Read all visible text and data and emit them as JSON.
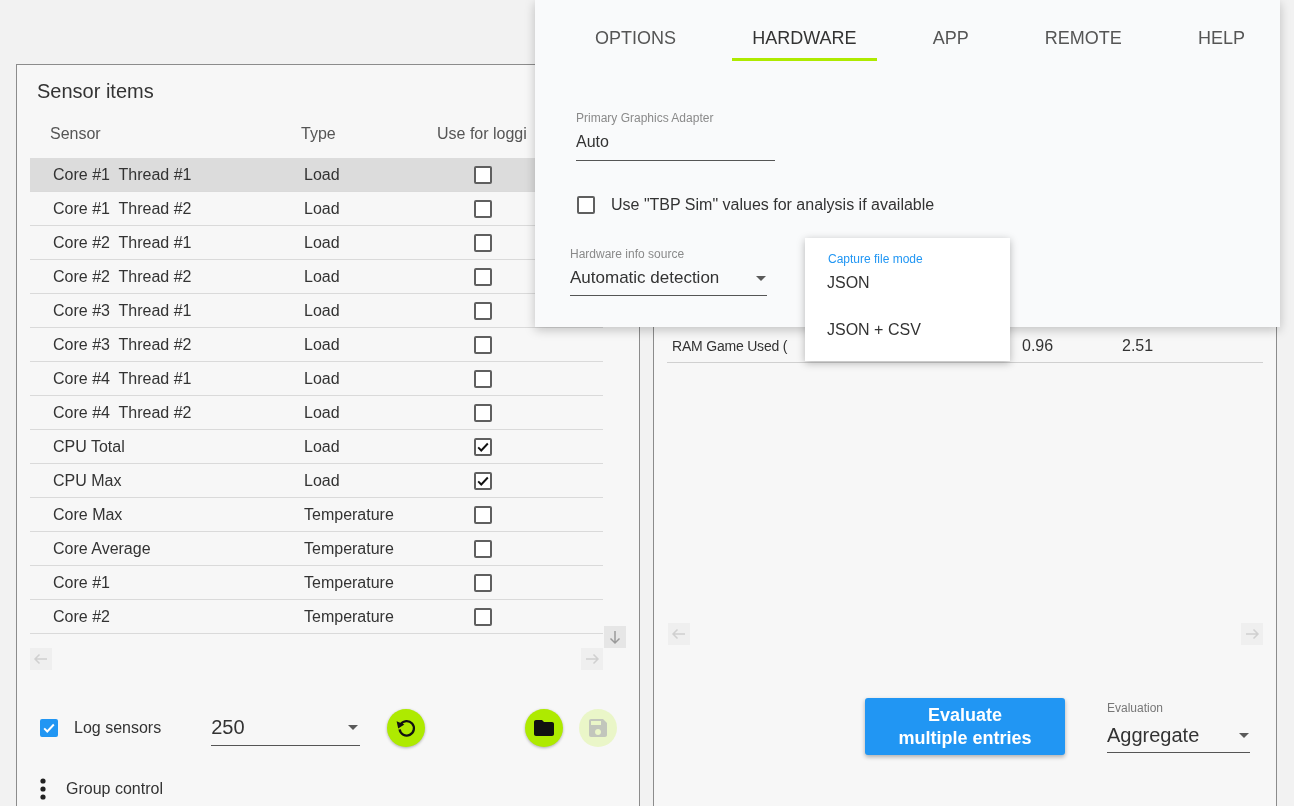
{
  "settings_dialog": {
    "tabs": [
      {
        "label": "OPTIONS",
        "selected": false
      },
      {
        "label": "HARDWARE",
        "selected": true
      },
      {
        "label": "APP",
        "selected": false
      },
      {
        "label": "REMOTE",
        "selected": false
      },
      {
        "label": "HELP",
        "selected": false
      }
    ],
    "primary_graphics_adapter": {
      "label": "Primary Graphics Adapter",
      "value": "Auto"
    },
    "tbp_sim": {
      "label": "Use \"TBP Sim\" values for analysis if available",
      "checked": false
    },
    "hardware_info_source": {
      "label": "Hardware info source",
      "value": "Automatic detection"
    },
    "capture_file_mode_menu": {
      "label": "Capture file mode",
      "options": [
        {
          "label": "JSON"
        },
        {
          "label": "JSON + CSV"
        }
      ]
    }
  },
  "sensor_panel": {
    "title": "Sensor items",
    "columns": [
      "Sensor",
      "Type",
      "Use for loggi"
    ],
    "rows": [
      {
        "sensor": "Core #1  Thread #1",
        "type": "Load",
        "checked": false,
        "selected": true
      },
      {
        "sensor": "Core #1  Thread #2",
        "type": "Load",
        "checked": false,
        "selected": false
      },
      {
        "sensor": "Core #2  Thread #1",
        "type": "Load",
        "checked": false,
        "selected": false
      },
      {
        "sensor": "Core #2  Thread #2",
        "type": "Load",
        "checked": false,
        "selected": false
      },
      {
        "sensor": "Core #3  Thread #1",
        "type": "Load",
        "checked": false,
        "selected": false
      },
      {
        "sensor": "Core #3  Thread #2",
        "type": "Load",
        "checked": false,
        "selected": false
      },
      {
        "sensor": "Core #4  Thread #1",
        "type": "Load",
        "checked": false,
        "selected": false
      },
      {
        "sensor": "Core #4  Thread #2",
        "type": "Load",
        "checked": false,
        "selected": false
      },
      {
        "sensor": "CPU Total",
        "type": "Load",
        "checked": true,
        "selected": false
      },
      {
        "sensor": "CPU Max",
        "type": "Load",
        "checked": true,
        "selected": false
      },
      {
        "sensor": "Core Max",
        "type": "Temperature",
        "checked": false,
        "selected": false
      },
      {
        "sensor": "Core Average",
        "type": "Temperature",
        "checked": false,
        "selected": false
      },
      {
        "sensor": "Core #1",
        "type": "Temperature",
        "checked": false,
        "selected": false
      },
      {
        "sensor": "Core #2",
        "type": "Temperature",
        "checked": false,
        "selected": false
      }
    ],
    "log_sensors": {
      "label": "Log sensors",
      "checked": true
    },
    "interval": {
      "value": "250"
    },
    "actions": [
      {
        "kind": "refresh",
        "disabled": false
      },
      {
        "kind": "folder",
        "disabled": false
      },
      {
        "kind": "save",
        "disabled": true
      }
    ],
    "group_control": {
      "label": "Group control"
    }
  },
  "evaluation_panel": {
    "rows": [
      {
        "cells": [
          "RAM Game Used (",
          "0.96",
          "2.51"
        ]
      }
    ],
    "evaluate_button": {
      "label": "Evaluate multiple entries"
    },
    "evaluation": {
      "label": "Evaluation",
      "value": "Aggregate"
    }
  }
}
